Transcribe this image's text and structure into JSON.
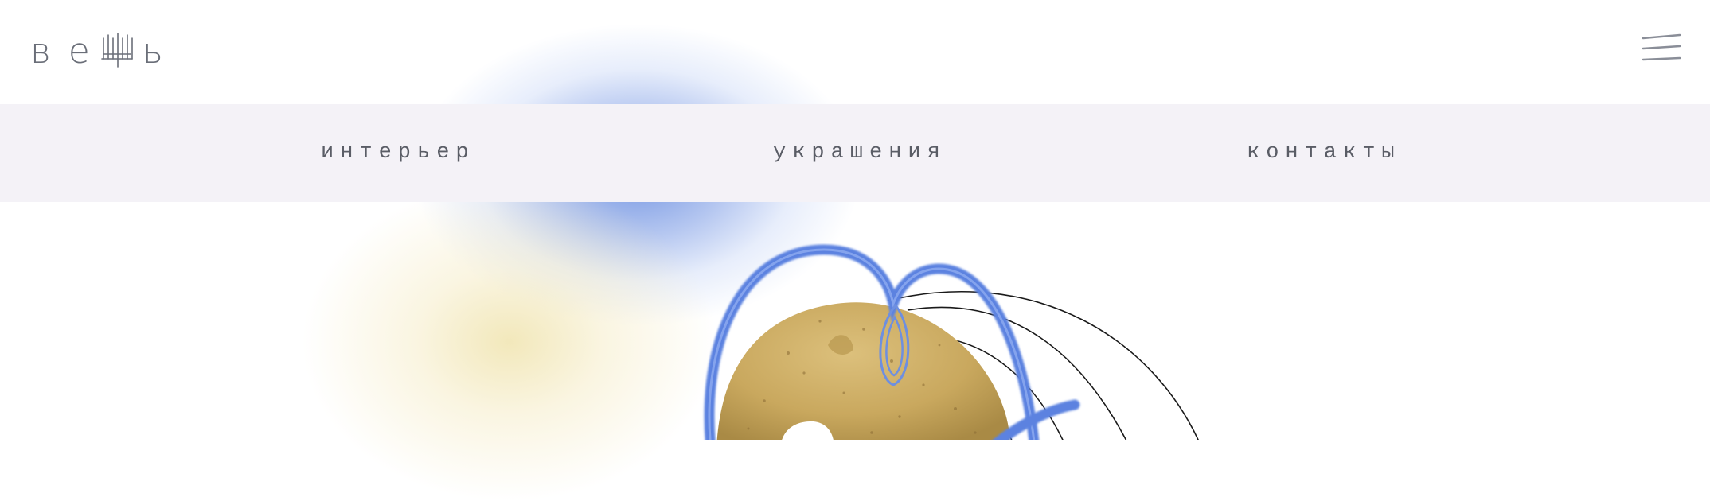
{
  "header": {
    "logo": {
      "letters": [
        "в",
        "е",
        "ь"
      ],
      "middle_icon": "candelabra-glyph-icon"
    },
    "menu_icon": "hamburger-icon"
  },
  "nav": {
    "items": [
      {
        "label": "интерьер"
      },
      {
        "label": "украшения"
      },
      {
        "label": "контакты"
      }
    ]
  },
  "hero": {
    "art": "sculpture-with-blue-loops",
    "colors": {
      "blue_accent": "#5b82e0",
      "sand": "#c9a85e",
      "line": "#1a1a1a"
    }
  },
  "colors": {
    "background": "#ffffff",
    "navbar_bg": "#f4f2f7",
    "text": "#5a5d66",
    "icon": "#8a8e98"
  }
}
